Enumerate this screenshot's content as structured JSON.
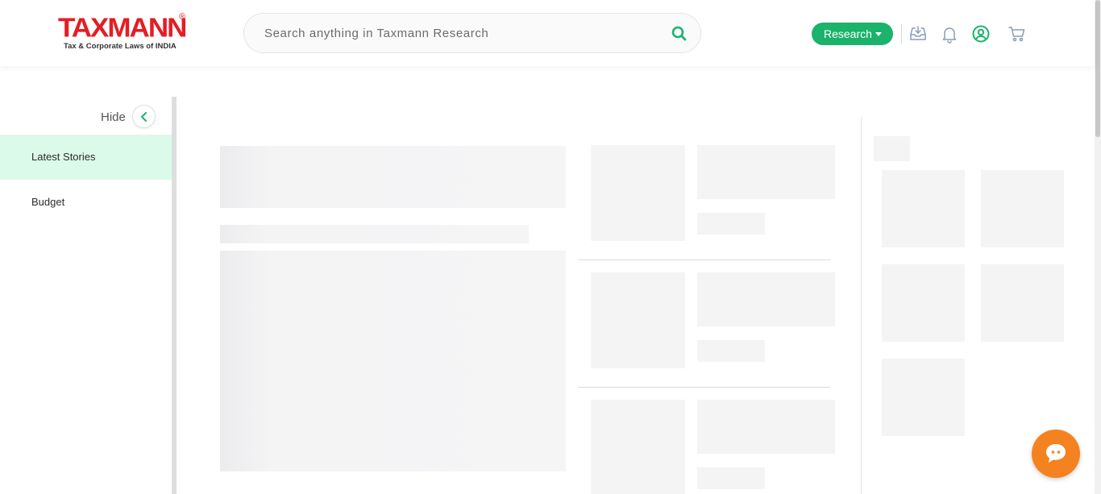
{
  "header": {
    "logo": {
      "wordmark": "TAXMANN",
      "registered": "®",
      "tagline": "Tax & Corporate Laws of INDIA"
    },
    "search": {
      "placeholder": "Search anything in Taxmann Research",
      "icon": "search-icon"
    },
    "research_button": {
      "label": "Research",
      "icon": "caret-down-icon"
    },
    "icons": [
      "inbox-download-icon",
      "bell-icon",
      "user-circle-icon",
      "cart-icon"
    ]
  },
  "sidebar": {
    "hide_label": "Hide",
    "hide_icon": "chevron-left-icon",
    "items": [
      {
        "label": "Latest Stories",
        "active": true
      },
      {
        "label": "Budget",
        "active": false
      }
    ]
  },
  "chat": {
    "icon": "chat-bubble-icon"
  },
  "colors": {
    "brand_red": "#e31e24",
    "accent_green": "#1bb36b",
    "active_nav_bg": "#dcfaea",
    "chat_orange": "#f58220",
    "skeleton": "#f4f4f5"
  }
}
